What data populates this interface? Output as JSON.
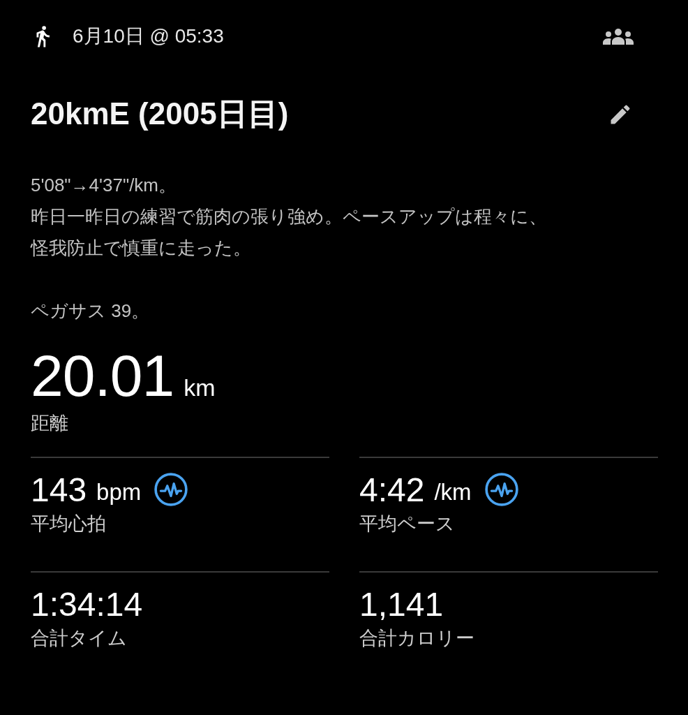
{
  "header": {
    "datetime": "6月10日 @ 05:33"
  },
  "title": "20kmE (2005日目)",
  "description": [
    {
      "lines": [
        "5'08\"→4'37\"/km。",
        "昨日一昨日の練習で筋肉の張り強め。ペースアップは程々に、",
        "怪我防止で慎重に走った。"
      ]
    },
    {
      "lines": [
        "ペガサス 39。"
      ]
    }
  ],
  "distance": {
    "value": "20.01",
    "unit": "km",
    "label": "距離"
  },
  "stats": [
    {
      "value": "143",
      "unit": "bpm",
      "label": "平均心拍",
      "chart_icon": true
    },
    {
      "value": "4:42",
      "unit": "/km",
      "label": "平均ペース",
      "chart_icon": true
    },
    {
      "value": "1:34:14",
      "label": "合計タイム",
      "chart_icon": false
    },
    {
      "value": "1,141",
      "label": "合計カロリー",
      "chart_icon": false
    }
  ]
}
